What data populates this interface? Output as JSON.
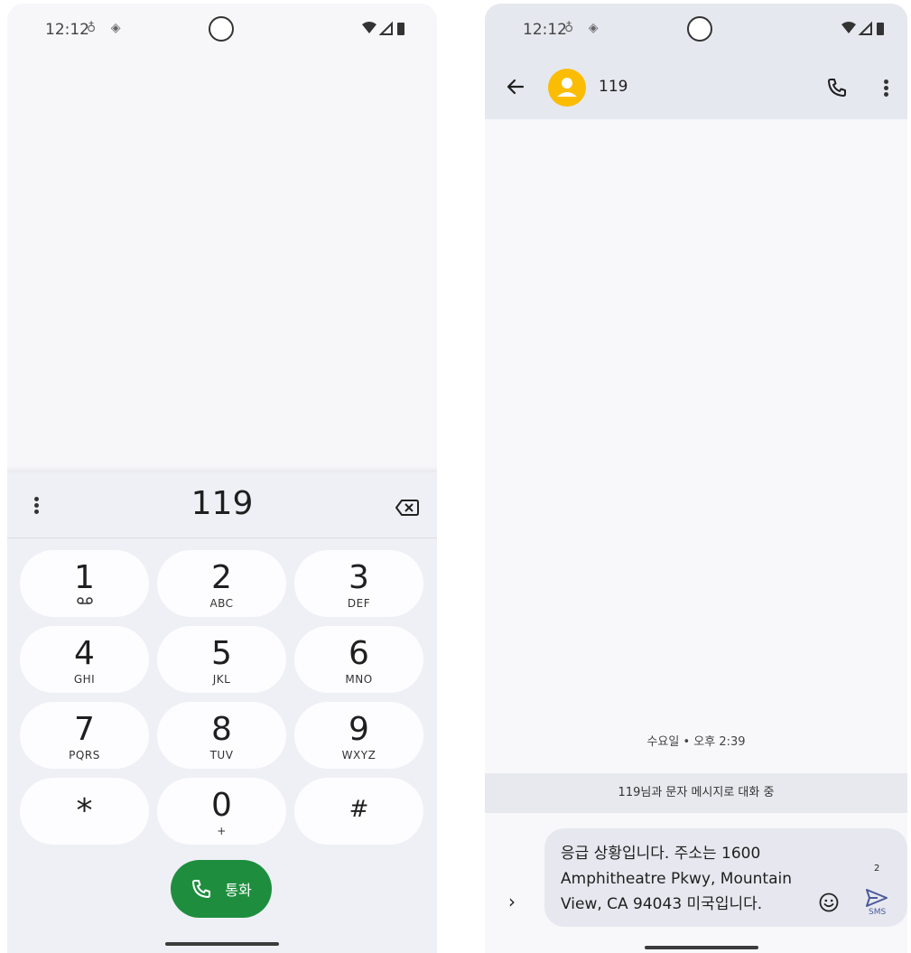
{
  "left_screen": {
    "status": {
      "time": "12:12"
    },
    "dialer": {
      "number": "119",
      "keys": [
        {
          "digit": "1",
          "letters": ""
        },
        {
          "digit": "2",
          "letters": "ABC"
        },
        {
          "digit": "3",
          "letters": "DEF"
        },
        {
          "digit": "4",
          "letters": "GHI"
        },
        {
          "digit": "5",
          "letters": "JKL"
        },
        {
          "digit": "6",
          "letters": "MNO"
        },
        {
          "digit": "7",
          "letters": "PQRS"
        },
        {
          "digit": "8",
          "letters": "TUV"
        },
        {
          "digit": "9",
          "letters": "WXYZ"
        },
        {
          "digit": "*",
          "letters": ""
        },
        {
          "digit": "0",
          "letters": "+"
        },
        {
          "digit": "#",
          "letters": ""
        }
      ],
      "call_label": "통화"
    }
  },
  "right_screen": {
    "status": {
      "time": "12:12"
    },
    "header": {
      "contact_name": "119"
    },
    "timestamp": "수요일 • 오후 2:39",
    "banner": "119님과 문자 메시지로 대화 중",
    "compose": {
      "text": "응급 상황입니다. 주소는 1600 Amphitheatre Pkwy, Mountain View, CA 94043 미국입니다.",
      "char_count": "2",
      "send_label": "SMS"
    }
  },
  "colors": {
    "call_green": "#1e8e3e",
    "avatar_yellow": "#fbbc04",
    "app_bar": "#e6e8ef"
  }
}
